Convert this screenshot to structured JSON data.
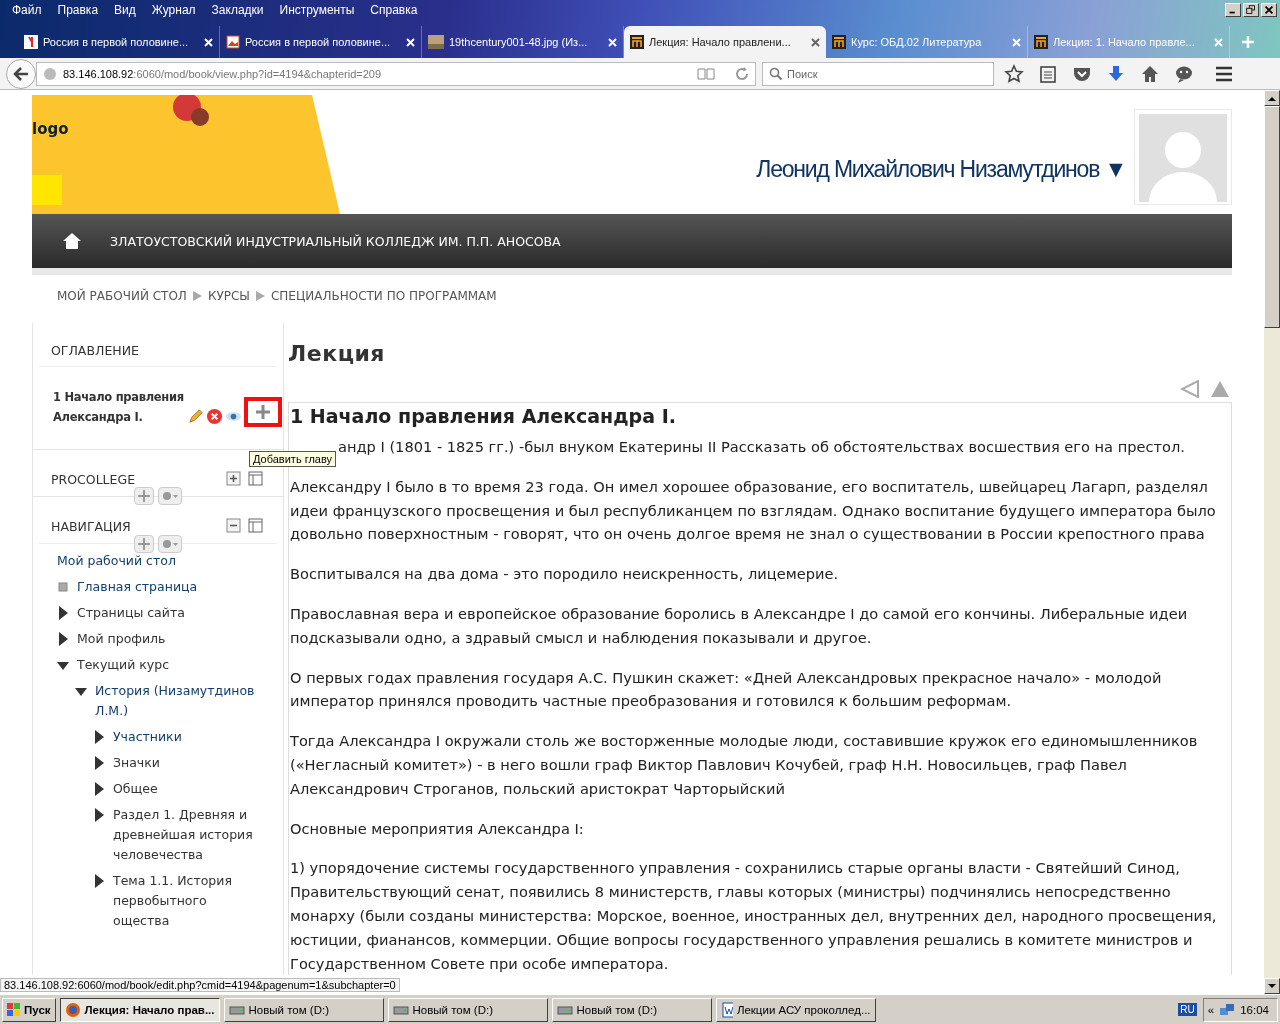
{
  "menu_bar": {
    "items": [
      "Файл",
      "Правка",
      "Вид",
      "Журнал",
      "Закладки",
      "Инструменты",
      "Справка"
    ]
  },
  "browser_tabs": [
    {
      "title": "Россия в первой половине...",
      "selected": false
    },
    {
      "title": "Россия в первой половине...",
      "selected": false
    },
    {
      "title": "19thcentury001-48.jpg (Из...",
      "selected": false
    },
    {
      "title": "Лекция: Начало правлени...",
      "selected": true
    },
    {
      "title": "Курс: ОБД.02 Литература",
      "selected": false
    },
    {
      "title": "Лекция: 1. Начало правле...",
      "selected": false
    }
  ],
  "address_bar": {
    "host": "83.146.108.92",
    "path": ":6060/mod/book/view.php?id=4194&chapterid=209"
  },
  "search": {
    "placeholder": "Поиск"
  },
  "header": {
    "logo_text": "logo",
    "user_name": "Леонид Михайлович Низамутдинов",
    "user_menu_caret": "▼"
  },
  "site_bar": {
    "title": "ЗЛАТОУСТОВСКИЙ ИНДУСТРИАЛЬНЫЙ КОЛЛЕДЖ ИМ. П.П. АНОСОВА"
  },
  "breadcrumb": [
    "МОЙ РАБОЧИЙ СТОЛ",
    "КУРСЫ",
    "СПЕЦИАЛЬНОСТИ ПО ПРОГРАММАМ"
  ],
  "toc_block": {
    "title": "ОГЛАВЛЕНИЕ",
    "chapter": "1 Начало правления Александра I.",
    "tooltip": "Добавить главу"
  },
  "procollege_block": {
    "title": "PROCOLLEGE",
    "expanded": false
  },
  "navigation_block": {
    "title": "НАВИГАЦИЯ",
    "expanded": true,
    "items": [
      {
        "label": "Мой рабочий стол",
        "kind": "root",
        "link": true
      },
      {
        "label": "Главная страница",
        "kind": "leaf",
        "link": true
      },
      {
        "label": "Страницы сайта",
        "kind": "branch",
        "link": false,
        "expanded": false
      },
      {
        "label": "Мой профиль",
        "kind": "branch",
        "link": false,
        "expanded": false
      },
      {
        "label": "Текущий курс",
        "kind": "branch",
        "link": false,
        "expanded": true,
        "children": [
          {
            "label": "История (Низамутдинов Л.М.)",
            "kind": "branch",
            "link": true,
            "expanded": true,
            "children": [
              {
                "label": "Участники",
                "kind": "branch",
                "link": true,
                "expanded": false
              },
              {
                "label": "Значки",
                "kind": "branch",
                "link": false,
                "expanded": false
              },
              {
                "label": "Общее",
                "kind": "branch",
                "link": false,
                "expanded": false
              },
              {
                "label": "Раздел 1. Древняя и древнейшая история человечества",
                "kind": "branch",
                "link": false,
                "expanded": false
              },
              {
                "label": "Тема 1.1. История первобытного ощества",
                "kind": "branch",
                "link": false,
                "expanded": false
              }
            ]
          }
        ]
      }
    ]
  },
  "content": {
    "page_title": "Лекция",
    "chapter_title": "1 Начало правления Александра I.",
    "paragraphs": [
      "андр I (1801 - 1825 гг.) -был внуком Екатерины II Рассказать об обстоятельствах восшествия его на престол.",
      "Александру I было в то время 23 года. Он имел хорошее образование, его воспитатель, швейцарец Лагарп, разделял идеи французского просвещения и был республиканцем по взглядам. Однако воспитание будущего императора было довольно поверхностным - говорят, что он очень долгое время не знал о существовании в России крепостного права",
      "Воспитывался на два дома - это породило неискренность, лицемерие.",
      "Православная вера и европейское образование боролись в Александре I до самой его кончины. Либеральные идеи подсказывали одно, а здравый смысл и наблюдения показывали и другое.",
      "О первых годах правления государя А.С. Пушкин скажет: «Дней Александровых прекрасное начало» - молодой император принялся проводить частные преобразования и готовился к большим реформам.",
      "Тогда Александра I окружали столь же восторженные молодые люди, составившие кружок его единомышленников («Негласный комитет») - в него вошли граф Виктор Павлович Кочубей, граф Н.Н. Новосильцев, граф Павел Александрович Строганов, польский аристократ Чарторыйский",
      "Основные мероприятия Александра I:",
      "1) упорядочение системы государственного управления - сохранились старые органы власти - Святейший Синод, Правительствующий сенат, появились 8 министерств, главы которых (министры) подчинялись непосредственно монарху (были созданы министерства: Морское, военное, иностранных дел, внутренних дел, народного просвещения, юстиции, фианансов, коммерции. Общие вопросы государственного управления решались в комитете министров и Государственном Совете при особе императора."
    ]
  },
  "status_url": "83.146.108.92:6060/mod/book/edit.php?cmid=4194&pagenum=1&subchapter=0",
  "taskbar": {
    "start": "Пуск",
    "tasks": [
      {
        "label": "Лекция: Начало прав...",
        "selected": true
      },
      {
        "label": "Новый том (D:)",
        "selected": false
      },
      {
        "label": "Новый том (D:)",
        "selected": false
      },
      {
        "label": "Новый том (D:)",
        "selected": false
      },
      {
        "label": "Лекции АСУ проколлед...",
        "selected": false
      }
    ],
    "language": "RU",
    "tray_toggle": "«",
    "clock": "16:04"
  }
}
